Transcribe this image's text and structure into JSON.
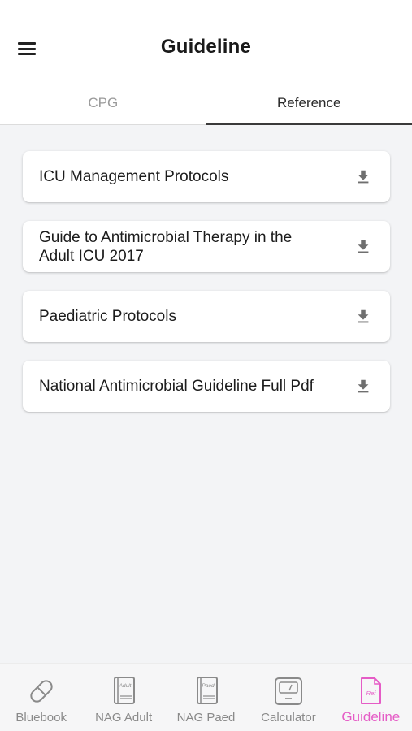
{
  "header": {
    "title": "Guideline"
  },
  "tabs": [
    {
      "label": "CPG",
      "active": false
    },
    {
      "label": "Reference",
      "active": true
    }
  ],
  "references": [
    {
      "label": "ICU Management Protocols",
      "icon": "download-icon"
    },
    {
      "label": "Guide to Antimicrobial Therapy in the Adult ICU 2017",
      "icon": "download-icon"
    },
    {
      "label": "Paediatric Protocols",
      "icon": "download-icon"
    },
    {
      "label": "National Antimicrobial Guideline Full Pdf",
      "icon": "download-icon"
    }
  ],
  "bottom_nav": {
    "items": [
      {
        "label": "Bluebook",
        "icon": "pill-icon"
      },
      {
        "label": "NAG Adult",
        "icon": "book-adult-icon",
        "icon_text": "Adult"
      },
      {
        "label": "NAG Paed",
        "icon": "book-paed-icon",
        "icon_text": "Paed"
      },
      {
        "label": "Calculator",
        "icon": "calculator-icon"
      },
      {
        "label": "Guideline",
        "icon": "ref-document-icon",
        "icon_text": "Ref",
        "active": true
      }
    ]
  },
  "colors": {
    "accent": "#e55cc6",
    "inactive": "#8a8a8a",
    "tab_indicator": "#3a3a3a"
  }
}
